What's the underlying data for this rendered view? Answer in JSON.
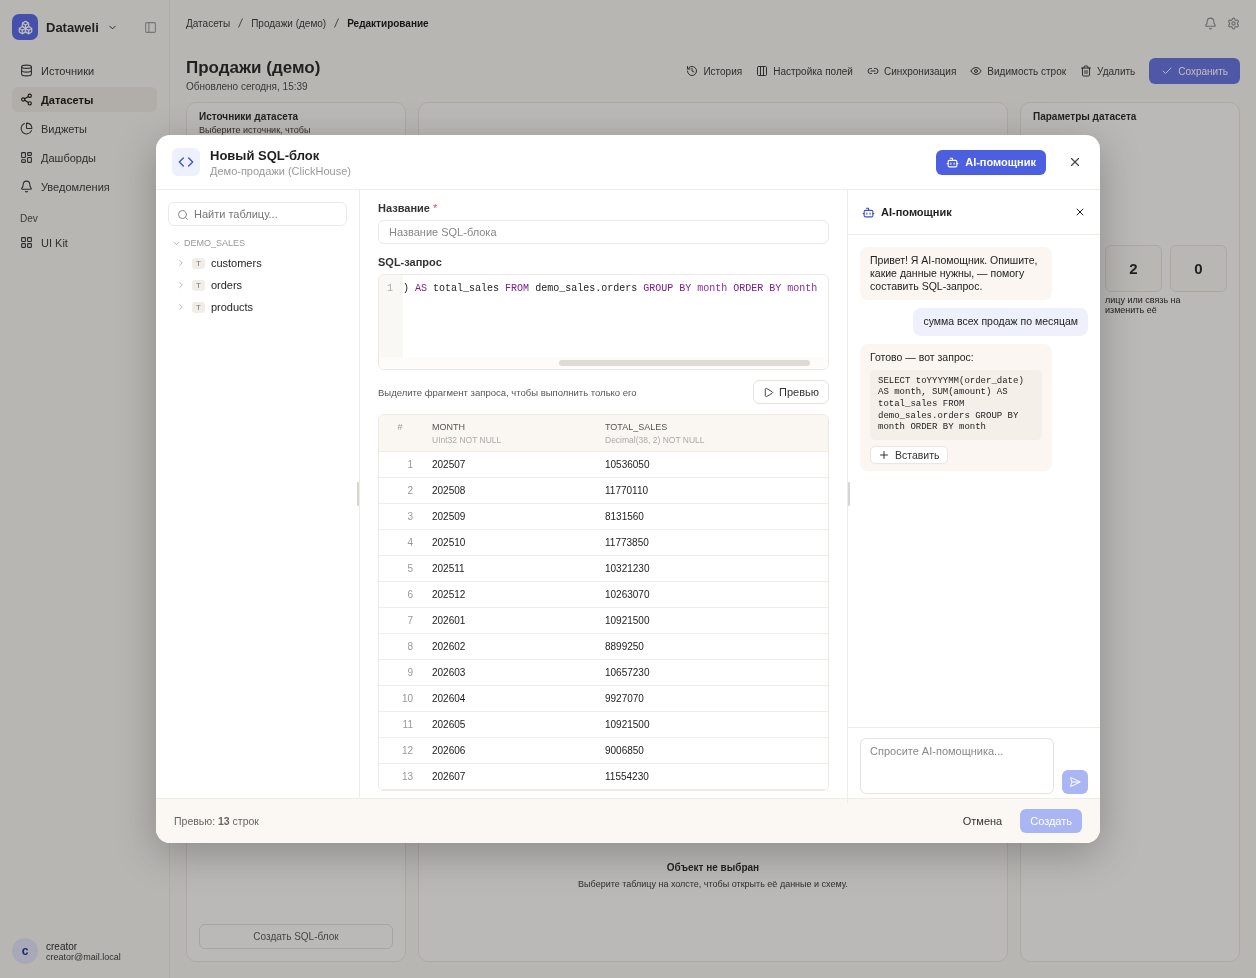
{
  "app": {
    "brand": "Dataweli",
    "nav": [
      {
        "label": "Источники",
        "selected": false
      },
      {
        "label": "Датасеты",
        "selected": true
      },
      {
        "label": "Виджеты",
        "selected": false
      },
      {
        "label": "Дашборды",
        "selected": false
      },
      {
        "label": "Уведомления",
        "selected": false
      }
    ],
    "section": "Dev",
    "dev_nav": [
      {
        "label": "UI Kit",
        "selected": false
      }
    ],
    "user": {
      "initial": "c",
      "name": "creator",
      "email": "creator@mail.local"
    }
  },
  "breadcrumbs": [
    "Датасеты",
    "Продажи (демо)",
    "Редактирование"
  ],
  "page": {
    "title": "Продажи (демо)",
    "subtitle": "Обновлено сегодня, 15:39"
  },
  "toolbar": [
    {
      "label": "История",
      "kind": "ghost"
    },
    {
      "label": "Настройка полей",
      "kind": "ghost"
    },
    {
      "label": "Синхронизация",
      "kind": "ghost"
    },
    {
      "label": "Видимость строк",
      "kind": "ghost"
    },
    {
      "label": "Удалить",
      "kind": "ghost"
    },
    {
      "label": "Сохранить",
      "kind": "primary"
    }
  ],
  "sources_card": {
    "title": "Источники датасета",
    "hint": "Выберите источник, чтобы",
    "create_button": "Создать SQL-блок"
  },
  "canvas": {
    "empty_title": "Объект не выбран",
    "empty_hint": "Выберите таблицу на холсте, чтобы открыть её данные и схему."
  },
  "params": {
    "title": "Параметры датасета",
    "stats": [
      "2",
      "0"
    ],
    "note": "лицу или связь на изменить её"
  },
  "dialog": {
    "title": "Новый SQL-блок",
    "subtitle": "Демо-продажи (ClickHouse)",
    "ai_button": {
      "label": "AI-помощник",
      "active": true
    },
    "tree": {
      "search_placeholder": "Найти таблицу...",
      "schema": {
        "name": "DEMO_SALES",
        "expanded": true,
        "children": [
          {
            "badge": "T",
            "name": "customers",
            "expanded": false
          },
          {
            "badge": "T",
            "name": "orders",
            "expanded": false
          },
          {
            "badge": "T",
            "name": "products",
            "expanded": false
          }
        ]
      }
    },
    "form": {
      "name_label": "Название",
      "required_mark": "*",
      "name_placeholder": "Название SQL-блока",
      "sql_label": "SQL-запрос",
      "line_number": "1",
      "tokens": [
        {
          "text": ")",
          "kind": "plain"
        },
        {
          "text": "AS",
          "kind": "keyword"
        },
        {
          "text": "total_sales",
          "kind": "plain"
        },
        {
          "text": "FROM",
          "kind": "keyword"
        },
        {
          "text": "demo_sales.orders",
          "kind": "plain"
        },
        {
          "text": "GROUP BY",
          "kind": "keyword"
        },
        {
          "text": "month",
          "kind": "ident"
        },
        {
          "text": "ORDER BY",
          "kind": "keyword"
        },
        {
          "text": "month",
          "kind": "ident"
        }
      ],
      "hint": "Выделите фрагмент запроса, чтобы выполнить только его",
      "preview_button": "Превью"
    },
    "table": {
      "columns": [
        {
          "name": "#"
        },
        {
          "name": "MONTH",
          "type": "UInt32 NOT NULL"
        },
        {
          "name": "TOTAL_SALES",
          "type": "Decimal(38, 2) NOT NULL"
        }
      ],
      "rows": [
        [
          "1",
          "202507",
          "10536050"
        ],
        [
          "2",
          "202508",
          "11770110"
        ],
        [
          "3",
          "202509",
          "8131560"
        ],
        [
          "4",
          "202510",
          "11773850"
        ],
        [
          "5",
          "202511",
          "10321230"
        ],
        [
          "6",
          "202512",
          "10263070"
        ],
        [
          "7",
          "202601",
          "10921500"
        ],
        [
          "8",
          "202602",
          "8899250"
        ],
        [
          "9",
          "202603",
          "10657230"
        ],
        [
          "10",
          "202604",
          "9927070"
        ],
        [
          "11",
          "202605",
          "10921500"
        ],
        [
          "12",
          "202606",
          "9006850"
        ],
        [
          "13",
          "202607",
          "11554230"
        ]
      ]
    },
    "chat": {
      "title": "AI-помощник",
      "messages": [
        {
          "kind": "assistant",
          "text": "Привет! Я AI-помощник. Опишите, какие данные нужны, — помогу составить SQL-запрос."
        },
        {
          "kind": "user",
          "text": "сумма всех продаж по месяцам"
        },
        {
          "kind": "assistant",
          "text": "Готово — вот запрос:",
          "code": "SELECT toYYYYMM(order_date) AS month, SUM(amount) AS total_sales FROM demo_sales.orders GROUP BY month ORDER BY month",
          "insert_button": "Вставить"
        }
      ],
      "input_placeholder": "Спросите AI-помощника...",
      "send_disabled": true
    },
    "footer": {
      "status": "Превью: **13** строк",
      "cancel": "Отмена",
      "create": {
        "label": "Создать",
        "disabled": true
      }
    }
  }
}
